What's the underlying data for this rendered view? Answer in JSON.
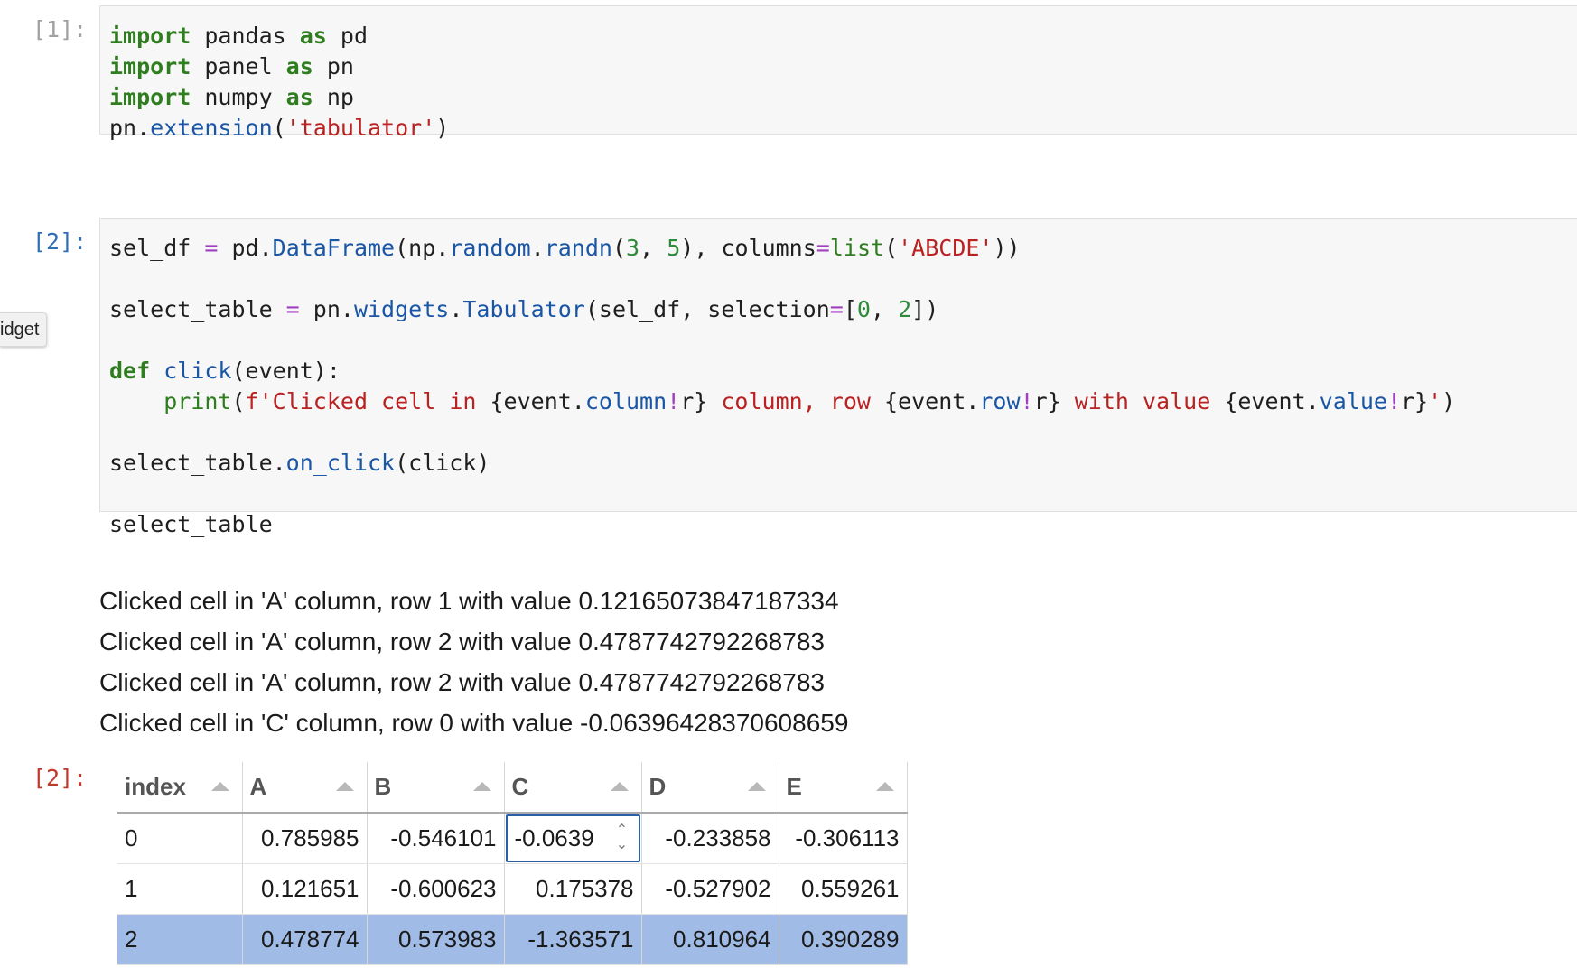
{
  "cells": [
    {
      "prompt": "[1]:",
      "code_lines": [
        [
          {
            "t": "import",
            "c": "kw"
          },
          {
            "t": " pandas "
          },
          {
            "t": "as",
            "c": "kw"
          },
          {
            "t": " pd"
          }
        ],
        [
          {
            "t": "import",
            "c": "kw"
          },
          {
            "t": " panel "
          },
          {
            "t": "as",
            "c": "kw"
          },
          {
            "t": " pn"
          }
        ],
        [
          {
            "t": "import",
            "c": "kw"
          },
          {
            "t": " numpy "
          },
          {
            "t": "as",
            "c": "kw"
          },
          {
            "t": " np"
          }
        ],
        [
          {
            "t": "pn."
          },
          {
            "t": "extension",
            "c": "fn"
          },
          {
            "t": "("
          },
          {
            "t": "'tabulator'",
            "c": "str"
          },
          {
            "t": ")"
          }
        ]
      ]
    },
    {
      "prompt": "[2]:",
      "code_lines": [
        [
          {
            "t": "sel_df "
          },
          {
            "t": "=",
            "c": "op"
          },
          {
            "t": " pd."
          },
          {
            "t": "DataFrame",
            "c": "fn"
          },
          {
            "t": "(np."
          },
          {
            "t": "random",
            "c": "fn"
          },
          {
            "t": "."
          },
          {
            "t": "randn",
            "c": "fn"
          },
          {
            "t": "("
          },
          {
            "t": "3",
            "c": "num"
          },
          {
            "t": ", "
          },
          {
            "t": "5",
            "c": "num"
          },
          {
            "t": "), columns"
          },
          {
            "t": "=",
            "c": "op"
          },
          {
            "t": "list",
            "c": "bi"
          },
          {
            "t": "("
          },
          {
            "t": "'ABCDE'",
            "c": "str"
          },
          {
            "t": "))"
          }
        ],
        [],
        [
          {
            "t": "select_table "
          },
          {
            "t": "=",
            "c": "op"
          },
          {
            "t": " pn."
          },
          {
            "t": "widgets",
            "c": "fn"
          },
          {
            "t": "."
          },
          {
            "t": "Tabulator",
            "c": "fn"
          },
          {
            "t": "(sel_df, selection"
          },
          {
            "t": "=",
            "c": "op"
          },
          {
            "t": "["
          },
          {
            "t": "0",
            "c": "num"
          },
          {
            "t": ", "
          },
          {
            "t": "2",
            "c": "num"
          },
          {
            "t": "])"
          }
        ],
        [],
        [
          {
            "t": "def",
            "c": "kw"
          },
          {
            "t": " "
          },
          {
            "t": "click",
            "c": "fn"
          },
          {
            "t": "(event):"
          }
        ],
        [
          {
            "t": "    "
          },
          {
            "t": "print",
            "c": "bi"
          },
          {
            "t": "("
          },
          {
            "t": "f'Clicked cell in ",
            "c": "str"
          },
          {
            "t": "{event."
          },
          {
            "t": "column",
            "c": "fn"
          },
          {
            "t": "!",
            "c": "op"
          },
          {
            "t": "r}"
          },
          {
            "t": " column, row ",
            "c": "str"
          },
          {
            "t": "{event."
          },
          {
            "t": "row",
            "c": "fn"
          },
          {
            "t": "!",
            "c": "op"
          },
          {
            "t": "r}"
          },
          {
            "t": " with value ",
            "c": "str"
          },
          {
            "t": "{event."
          },
          {
            "t": "value",
            "c": "fn"
          },
          {
            "t": "!",
            "c": "op"
          },
          {
            "t": "r}"
          },
          {
            "t": "'",
            "c": "str"
          },
          {
            "t": ")"
          }
        ],
        [],
        [
          {
            "t": "select_table."
          },
          {
            "t": "on_click",
            "c": "fn"
          },
          {
            "t": "(click)"
          }
        ],
        [],
        [
          {
            "t": "select_table"
          }
        ]
      ]
    }
  ],
  "tooltip": "idget",
  "stdout": [
    "Clicked cell in 'A' column, row 1 with value 0.12165073847187334",
    "Clicked cell in 'A' column, row 2 with value 0.4787742792268783",
    "Clicked cell in 'A' column, row 2 with value 0.4787742792268783",
    "Clicked cell in 'C' column, row 0 with value -0.06396428370608659"
  ],
  "output_prompt": "[2]:",
  "table": {
    "columns": [
      "index",
      "A",
      "B",
      "C",
      "D",
      "E"
    ],
    "rows": [
      {
        "index": "0",
        "A": "0.785985",
        "B": "-0.546101",
        "C": "-0.0639",
        "D": "-0.233858",
        "E": "-0.306113",
        "selected": false
      },
      {
        "index": "1",
        "A": "0.121651",
        "B": "-0.600623",
        "C": "0.175378",
        "D": "-0.527902",
        "E": "0.559261",
        "selected": false
      },
      {
        "index": "2",
        "A": "0.478774",
        "B": "0.573983",
        "C": "-1.363571",
        "D": "0.810964",
        "E": "0.390289",
        "selected": true
      }
    ],
    "editing_cell": {
      "row": 0,
      "column": "C"
    },
    "selected_row_color": "#9fbbe6"
  }
}
